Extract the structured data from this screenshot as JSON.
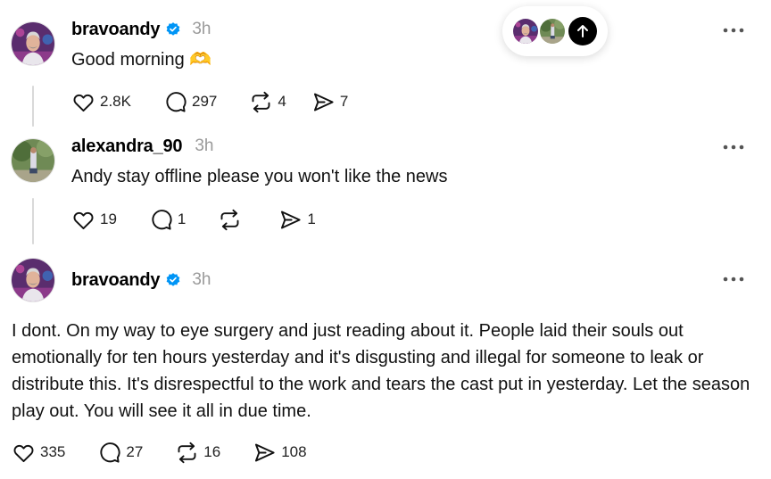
{
  "posts": [
    {
      "username": "bravoandy",
      "verified": true,
      "time": "3h",
      "text": "Good morning 🫶",
      "likes": "2.8K",
      "replies": "297",
      "reposts": "4",
      "shares": "7"
    },
    {
      "username": "alexandra_90",
      "verified": false,
      "time": "3h",
      "text": "Andy stay offline please you won't like the news",
      "likes": "19",
      "replies": "1",
      "reposts": "",
      "shares": "1"
    },
    {
      "username": "bravoandy",
      "verified": true,
      "time": "3h",
      "text": "I dont. On my way to eye surgery and just reading about it. People laid their souls out emotionally for ten hours yesterday and it's disgusting and illegal for someone to leak or distribute this. It's disrespectful to the work and tears the cast put in yesterday. Let the season play out. You will see it all in due time.",
      "likes": "335",
      "replies": "27",
      "reposts": "16",
      "shares": "108"
    }
  ],
  "colors": {
    "verified": "#0095f6",
    "muted": "#9a9a9a",
    "thread_line": "#d9d9d9"
  },
  "icons": [
    "heart-icon",
    "reply-icon",
    "repost-icon",
    "share-icon",
    "more-icon",
    "verified-icon",
    "arrow-up-icon"
  ]
}
